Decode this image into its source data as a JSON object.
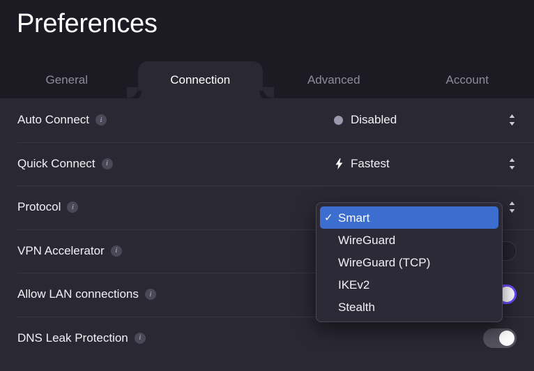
{
  "window": {
    "title": "Preferences"
  },
  "tabs": [
    {
      "label": "General",
      "active": false
    },
    {
      "label": "Connection",
      "active": true
    },
    {
      "label": "Advanced",
      "active": false
    },
    {
      "label": "Account",
      "active": false
    }
  ],
  "settings": {
    "rows": [
      {
        "label": "Auto Connect",
        "info_icon": "info-icon",
        "control": "popup-button",
        "value": "Disabled",
        "value_icon": "gray-circle-icon",
        "stepper_icon": "up-down-chevron-icon"
      },
      {
        "label": "Quick Connect",
        "info_icon": "info-icon",
        "control": "popup-button",
        "value": "Fastest",
        "value_icon": "lightning-bolt-icon",
        "stepper_icon": "up-down-chevron-icon"
      },
      {
        "label": "Protocol",
        "info_icon": "info-icon",
        "control": "popup-button",
        "value": "Smart",
        "value_icon": "none",
        "stepper_icon": "up-down-chevron-icon"
      },
      {
        "label": "VPN Accelerator",
        "info_icon": "info-icon",
        "control": "toggle",
        "toggle_state": "off"
      },
      {
        "label": "Allow LAN connections",
        "info_icon": "info-icon",
        "control": "toggle",
        "toggle_state": "on"
      },
      {
        "label": "DNS Leak Protection",
        "info_icon": "info-icon",
        "control": "toggle",
        "toggle_state": "on-disabled"
      }
    ]
  },
  "protocol_dropdown": {
    "open": true,
    "selected": "Smart",
    "options": [
      {
        "label": "Smart",
        "selected": true
      },
      {
        "label": "WireGuard",
        "selected": false
      },
      {
        "label": "WireGuard (TCP)",
        "selected": false
      },
      {
        "label": "IKEv2",
        "selected": false
      },
      {
        "label": "Stealth",
        "selected": false
      }
    ],
    "check_glyph": "✓"
  },
  "colors": {
    "header_bg": "#1c1b24",
    "body_bg": "#2a2833",
    "accent_purple": "#6d4aff",
    "menu_highlight_blue": "#3c6ed0",
    "text_primary": "#f2f1f6",
    "text_muted": "#8e8c9c",
    "divider": "#383645"
  }
}
